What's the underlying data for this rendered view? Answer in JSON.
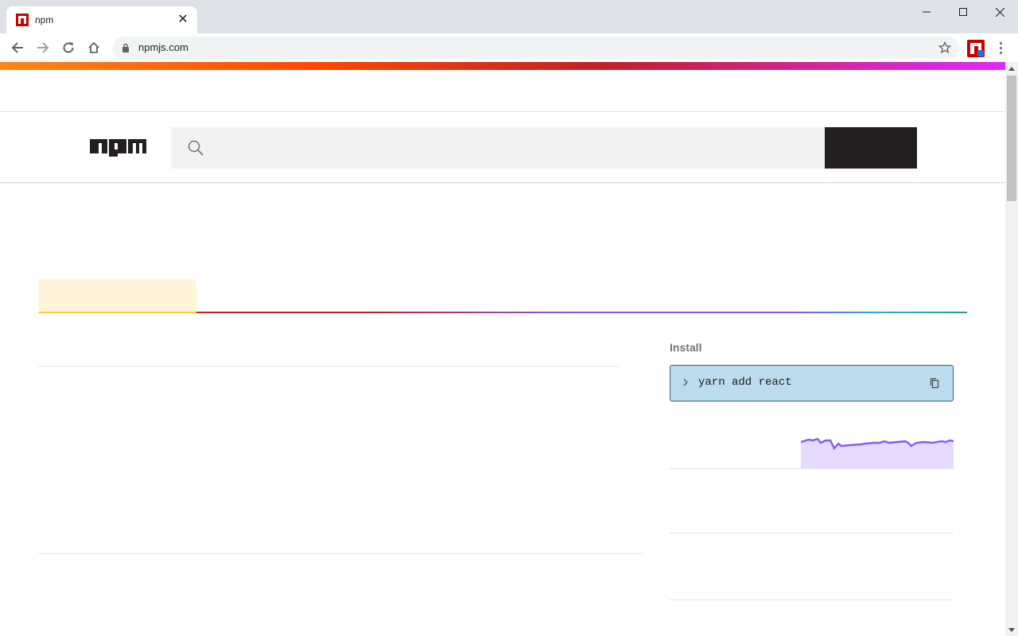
{
  "browser": {
    "tab": {
      "title": "npm",
      "close": "✕"
    },
    "url": "npmjs.com"
  },
  "colors": {
    "npm_red": "#cb0000",
    "install_bg": "#bbdcec",
    "install_border": "#2b6587",
    "spark_line": "#8956ff",
    "spark_fill": "#e6dbff"
  },
  "install": {
    "label": "Install",
    "command": "yarn add react"
  },
  "icons": {
    "favicon": "npm-favicon-icon",
    "back": "back-arrow-icon",
    "forward": "forward-arrow-icon",
    "reload": "reload-icon",
    "home": "home-icon",
    "lock": "lock-icon",
    "star": "star-icon",
    "search": "search-icon",
    "copy": "copy-icon",
    "prompt": "chevron-right-icon"
  }
}
